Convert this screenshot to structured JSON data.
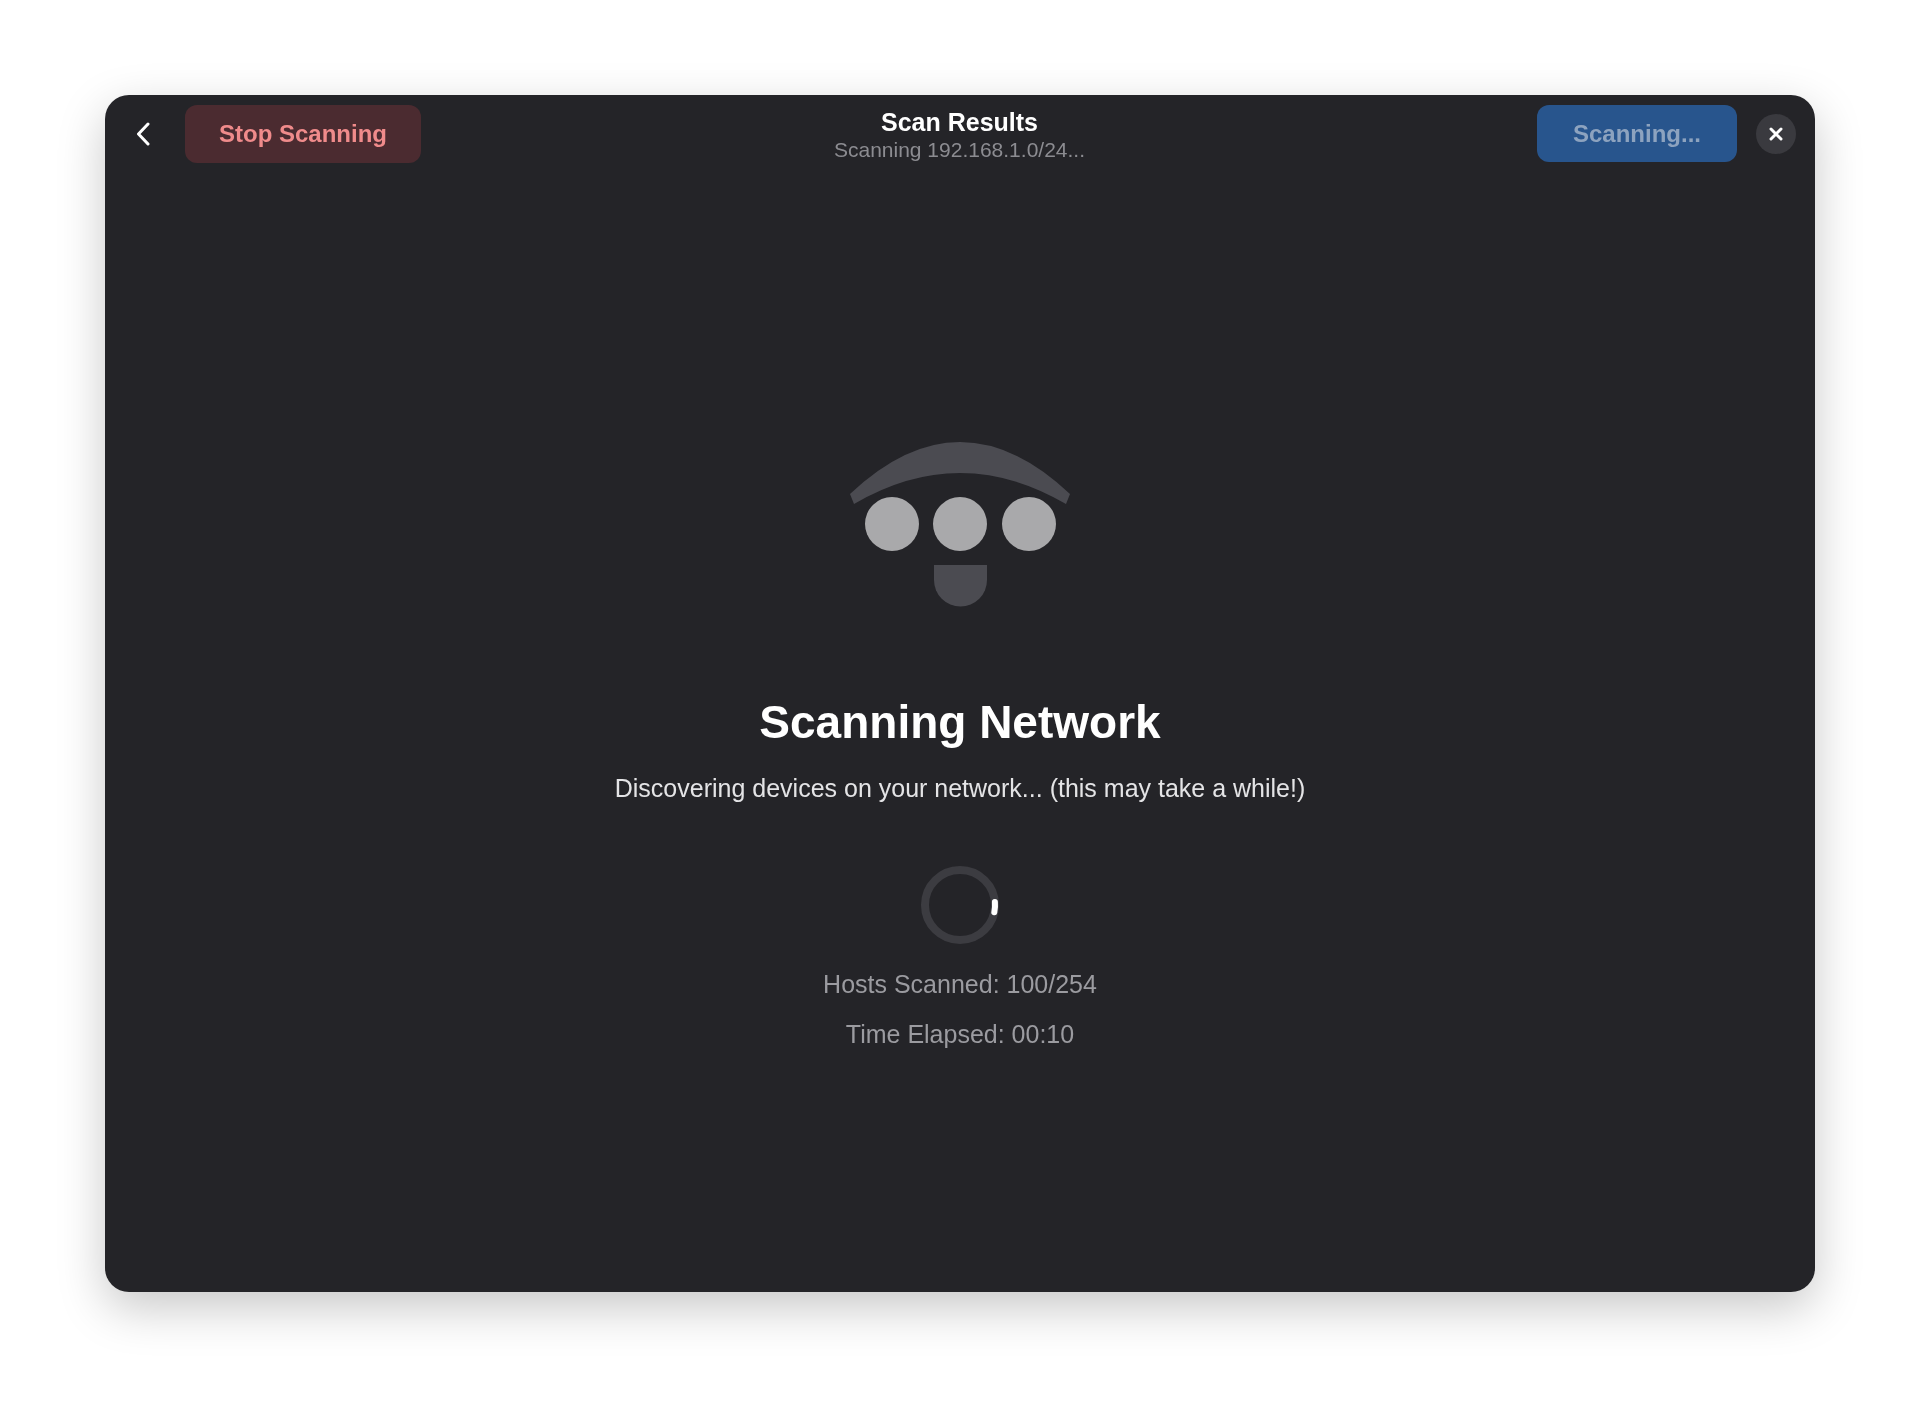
{
  "window": {
    "title": "Scan Results",
    "subtitle": "Scanning 192.168.1.0/24..."
  },
  "toolbar": {
    "stop_button": {
      "label": "Stop Scanning"
    },
    "scan_button": {
      "label": "Scanning...",
      "disabled": true
    }
  },
  "status": {
    "heading": "Scanning Network",
    "message": "Discovering devices on your network... (this may take a while!)",
    "stats": [
      "Hosts Scanned: 100/254",
      "Time Elapsed: 00:10"
    ]
  }
}
